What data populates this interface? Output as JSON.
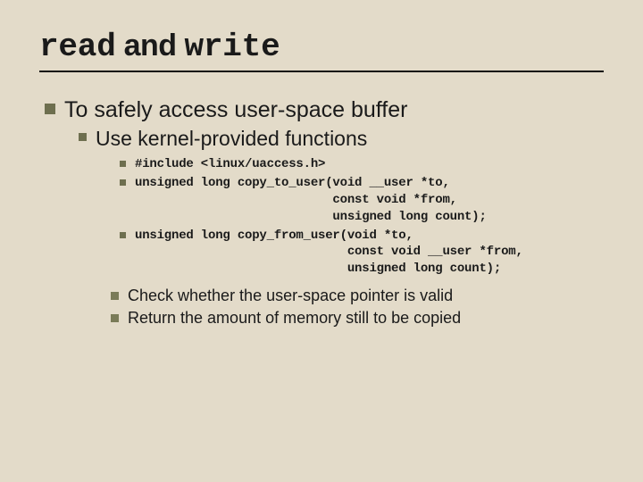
{
  "title": {
    "code1": "read",
    "mid": " and ",
    "code2": "write"
  },
  "l1": "To safely access user-space buffer",
  "l2": "Use kernel-provided functions",
  "code": {
    "line1": "#include <linux/uaccess.h>",
    "line2": "unsigned long copy_to_user(void __user *to,\n                           const void *from,\n                           unsigned long count);",
    "line3": "unsigned long copy_from_user(void *to,\n                             const void __user *from,\n                             unsigned long count);"
  },
  "notes": {
    "a": "Check whether the user-space pointer is valid",
    "b": "Return the amount of memory still to be copied"
  }
}
